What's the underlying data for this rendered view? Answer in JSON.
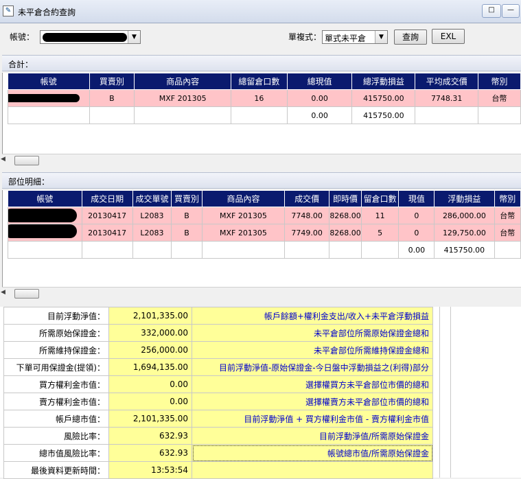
{
  "window": {
    "title": "未平倉合約查詢",
    "btn_restore": "□",
    "btn_min": "—"
  },
  "toolbar": {
    "account_label": "帳號：",
    "mode_label": "單複式：",
    "mode_value": "單式未平倉",
    "query_label": "查詢",
    "exl_label": "EXL"
  },
  "totals": {
    "section_label": "合計：",
    "columns": [
      "帳號",
      "買賣別",
      "商品內容",
      "總留倉口數",
      "總現值",
      "總浮動損益",
      "平均成交價",
      "幣別"
    ],
    "rows": [
      [
        "",
        "B",
        "MXF 201305",
        "16",
        "0.00",
        "415750.00",
        "7748.31",
        "台幣"
      ],
      [
        "",
        "",
        "",
        "",
        "0.00",
        "415750.00",
        "",
        ""
      ]
    ]
  },
  "detail": {
    "section_label": "部位明細：",
    "columns": [
      "帳號",
      "成交日期",
      "成交單號",
      "買賣別",
      "商品內容",
      "成交價",
      "即時價",
      "留倉口數",
      "現值",
      "浮動損益",
      "幣別"
    ],
    "rows": [
      [
        "",
        "20130417",
        "L2083",
        "B",
        "MXF 201305",
        "7748.00",
        "8268.00",
        "11",
        "0",
        "286,000.00",
        "台幣"
      ],
      [
        "",
        "20130417",
        "L2083",
        "B",
        "MXF 201305",
        "7749.00",
        "8268.00",
        "5",
        "0",
        "129,750.00",
        "台幣"
      ],
      [
        "",
        "",
        "",
        "",
        "",
        "",
        "",
        "",
        "0.00",
        "415750.00",
        ""
      ]
    ]
  },
  "summary": [
    {
      "label": "目前浮動淨值：",
      "value": "2,101,335.00",
      "formula": "帳戶餘額+權利金支出/收入+未平倉浮動損益"
    },
    {
      "label": "所需原始保證金：",
      "value": "332,000.00",
      "formula": "未平倉部位所需原始保證金總和"
    },
    {
      "label": "所需維持保證金：",
      "value": "256,000.00",
      "formula": "未平倉部位所需維持保證金總和"
    },
    {
      "label": "下單可用保證金(提領)：",
      "value": "1,694,135.00",
      "formula": "目前浮動淨值-原始保證金-今日盤中浮動損益之(利得)部分"
    },
    {
      "label": "買方權利金市值：",
      "value": "0.00",
      "formula": "選擇權買方未平倉部位市價的總和"
    },
    {
      "label": "賣方權利金市值：",
      "value": "0.00",
      "formula": "選擇權賣方未平倉部位市價的總和"
    },
    {
      "label": "帳戶總市值：",
      "value": "2,101,335.00",
      "formula": "目前浮動淨值 + 買方權利金市值 - 賣方權利金市值"
    },
    {
      "label": "風險比率：",
      "value": "632.93",
      "formula": "目前浮動淨值/所需原始保證金"
    },
    {
      "label": "總市值風險比率：",
      "value": "632.93",
      "formula": "帳號總市值/所需原始保證金"
    },
    {
      "label": "最後資料更新時間：",
      "value": "13:53:54",
      "formula": ""
    }
  ]
}
